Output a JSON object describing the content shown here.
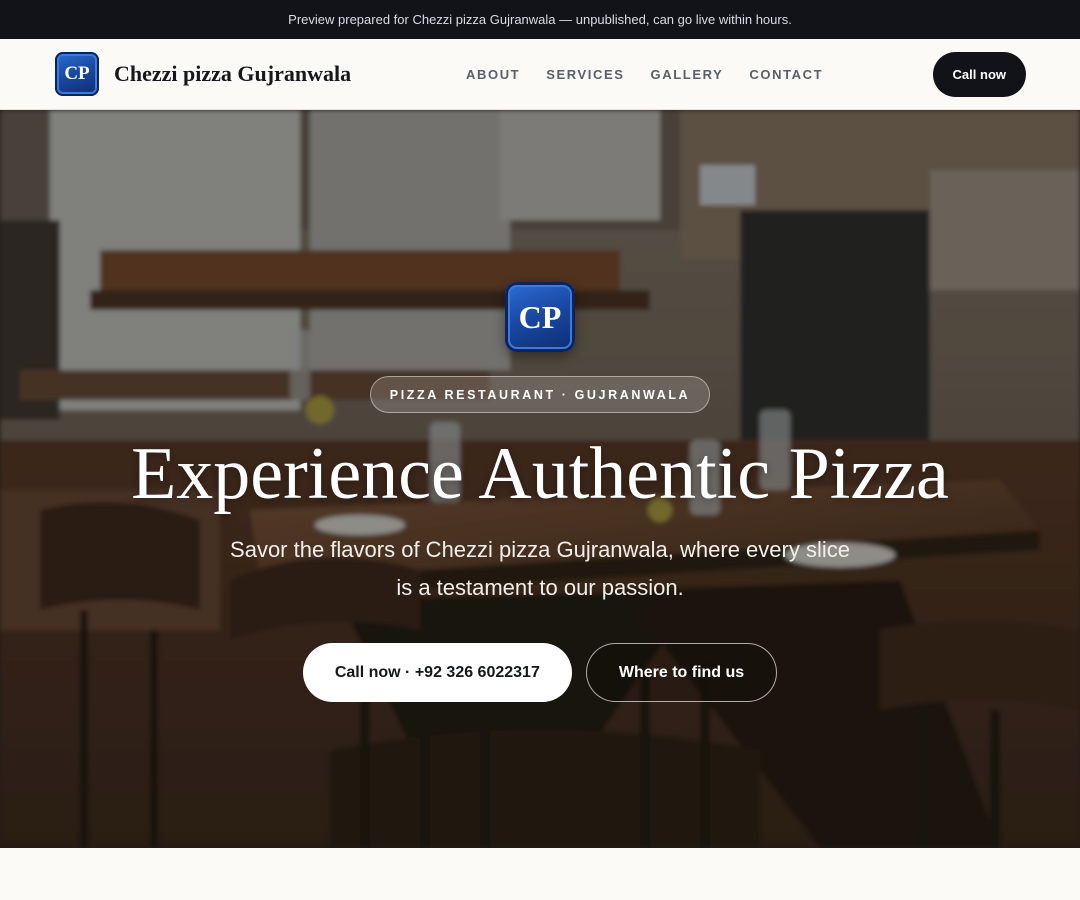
{
  "preview_bar": {
    "text": "Preview prepared for Chezzi pizza Gujranwala — unpublished, can go live within hours."
  },
  "nav": {
    "logo_text": "CP",
    "brand_name": "Chezzi pizza Gujranwala",
    "links": [
      {
        "label": "ABOUT"
      },
      {
        "label": "SERVICES"
      },
      {
        "label": "GALLERY"
      },
      {
        "label": "CONTACT"
      }
    ],
    "cta_label": "Call now"
  },
  "hero": {
    "logo_text": "CP",
    "eyebrow": "PIZZA RESTAURANT · GUJRANWALA",
    "title": "Experience Authentic Pizza",
    "subtitle": "Savor the flavors of Chezzi pizza Gujranwala, where every slice is a testament to our passion.",
    "primary_cta": "Call now · +92 326 6022317",
    "secondary_cta": "Where to find us"
  },
  "colors": {
    "dark": "#111318",
    "page_bg": "#fbfaf7",
    "logo_blue": "#1a4aa5",
    "wood": "#6b3f24"
  }
}
